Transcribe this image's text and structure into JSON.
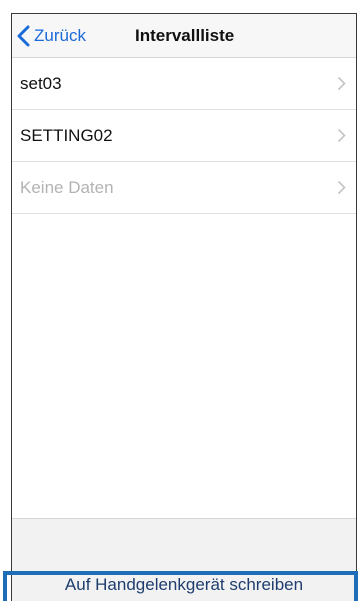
{
  "navbar": {
    "back_label": "Zurück",
    "title": "Intervallliste"
  },
  "list": {
    "items": [
      {
        "label": "set03",
        "disabled": false
      },
      {
        "label": "SETTING02",
        "disabled": false
      },
      {
        "label": "Keine Daten",
        "disabled": true
      }
    ]
  },
  "footer": {
    "write_label": "Auf Handgelenkgerät schreiben"
  },
  "colors": {
    "accent": "#1a6ad8",
    "highlight": "#1f6db7",
    "disabled_text": "#b3b3b3"
  },
  "icons": {
    "back": "chevron-left-icon",
    "row": "chevron-right-icon"
  }
}
